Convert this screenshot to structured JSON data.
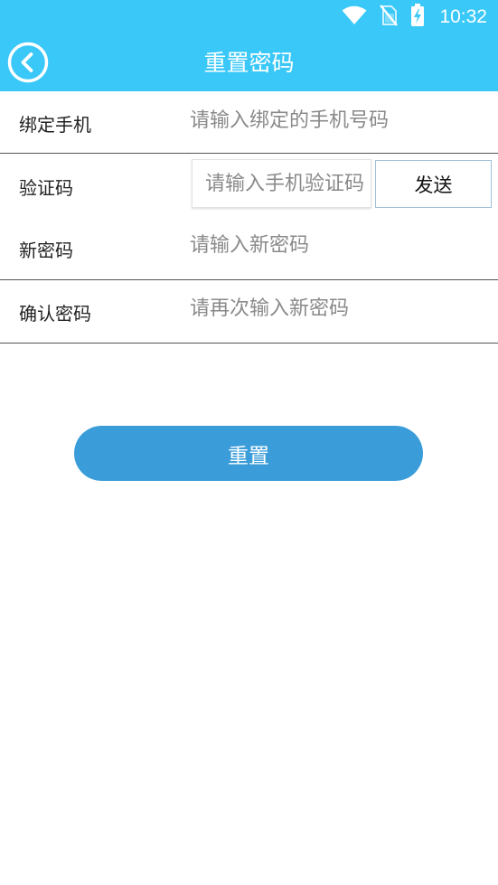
{
  "status_bar": {
    "time": "10:32",
    "icons": [
      "wifi-icon",
      "no-sim-icon",
      "battery-charging-icon"
    ]
  },
  "header": {
    "title": "重置密码",
    "back_icon": "back-circle-icon"
  },
  "form": {
    "phone": {
      "label": "绑定手机",
      "placeholder": "请输入绑定的手机号码"
    },
    "code": {
      "label": "验证码",
      "placeholder": "请输入手机验证码",
      "send_label": "发送"
    },
    "new_password": {
      "label": "新密码",
      "placeholder": "请输入新密码"
    },
    "confirm_password": {
      "label": "确认密码",
      "placeholder": "请再次输入新密码"
    }
  },
  "actions": {
    "reset_label": "重置"
  },
  "colors": {
    "primary": "#39c8f8",
    "button": "#3a9dd9",
    "divider": "#555555",
    "placeholder": "#8a8a8a"
  }
}
